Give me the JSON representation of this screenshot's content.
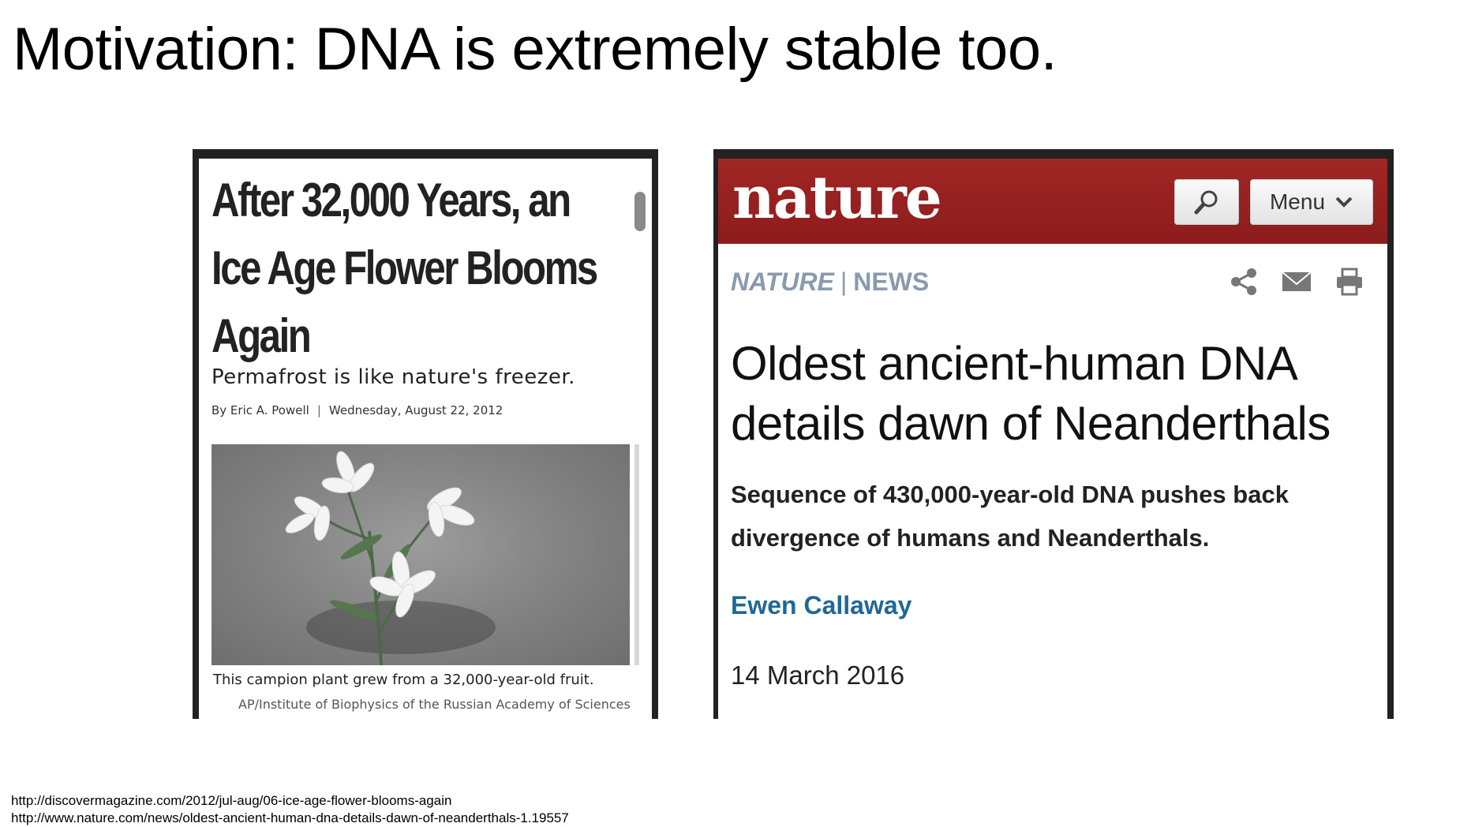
{
  "slide": {
    "title": "Motivation: DNA is extremely stable too."
  },
  "discover_article": {
    "headline": "After 32,000 Years, an Ice Age Flower Blooms Again",
    "subhead": "Permafrost is like nature's freezer.",
    "author": "By Eric A. Powell",
    "separator": "|",
    "date": "Wednesday, August 22, 2012",
    "image_caption": "This campion plant grew from a 32,000-year-old fruit.",
    "image_credit": "AP/Institute of Biophysics of the Russian Academy of Sciences"
  },
  "nature_article": {
    "logo": "nature",
    "menu_label": "Menu",
    "section_brand": "NATURE",
    "section_separator": "|",
    "section_name": "NEWS",
    "headline": "Oldest ancient-human DNA details dawn of Neanderthals",
    "standfirst": "Sequence of 430,000-year-old DNA pushes back divergence of humans and Neanderthals.",
    "author": "Ewen Callaway",
    "date": "14 March 2016",
    "colors": {
      "header_red": "#8d1c1c",
      "section_gray": "#8a9aae",
      "author_blue": "#1f6896"
    },
    "icons": [
      "search-icon",
      "chevron-down-icon",
      "share-icon",
      "email-icon",
      "print-icon"
    ]
  },
  "sources": [
    "http://discovermagazine.com/2012/jul-aug/06-ice-age-flower-blooms-again",
    "http://www.nature.com/news/oldest-ancient-human-dna-details-dawn-of-neanderthals-1.19557"
  ]
}
